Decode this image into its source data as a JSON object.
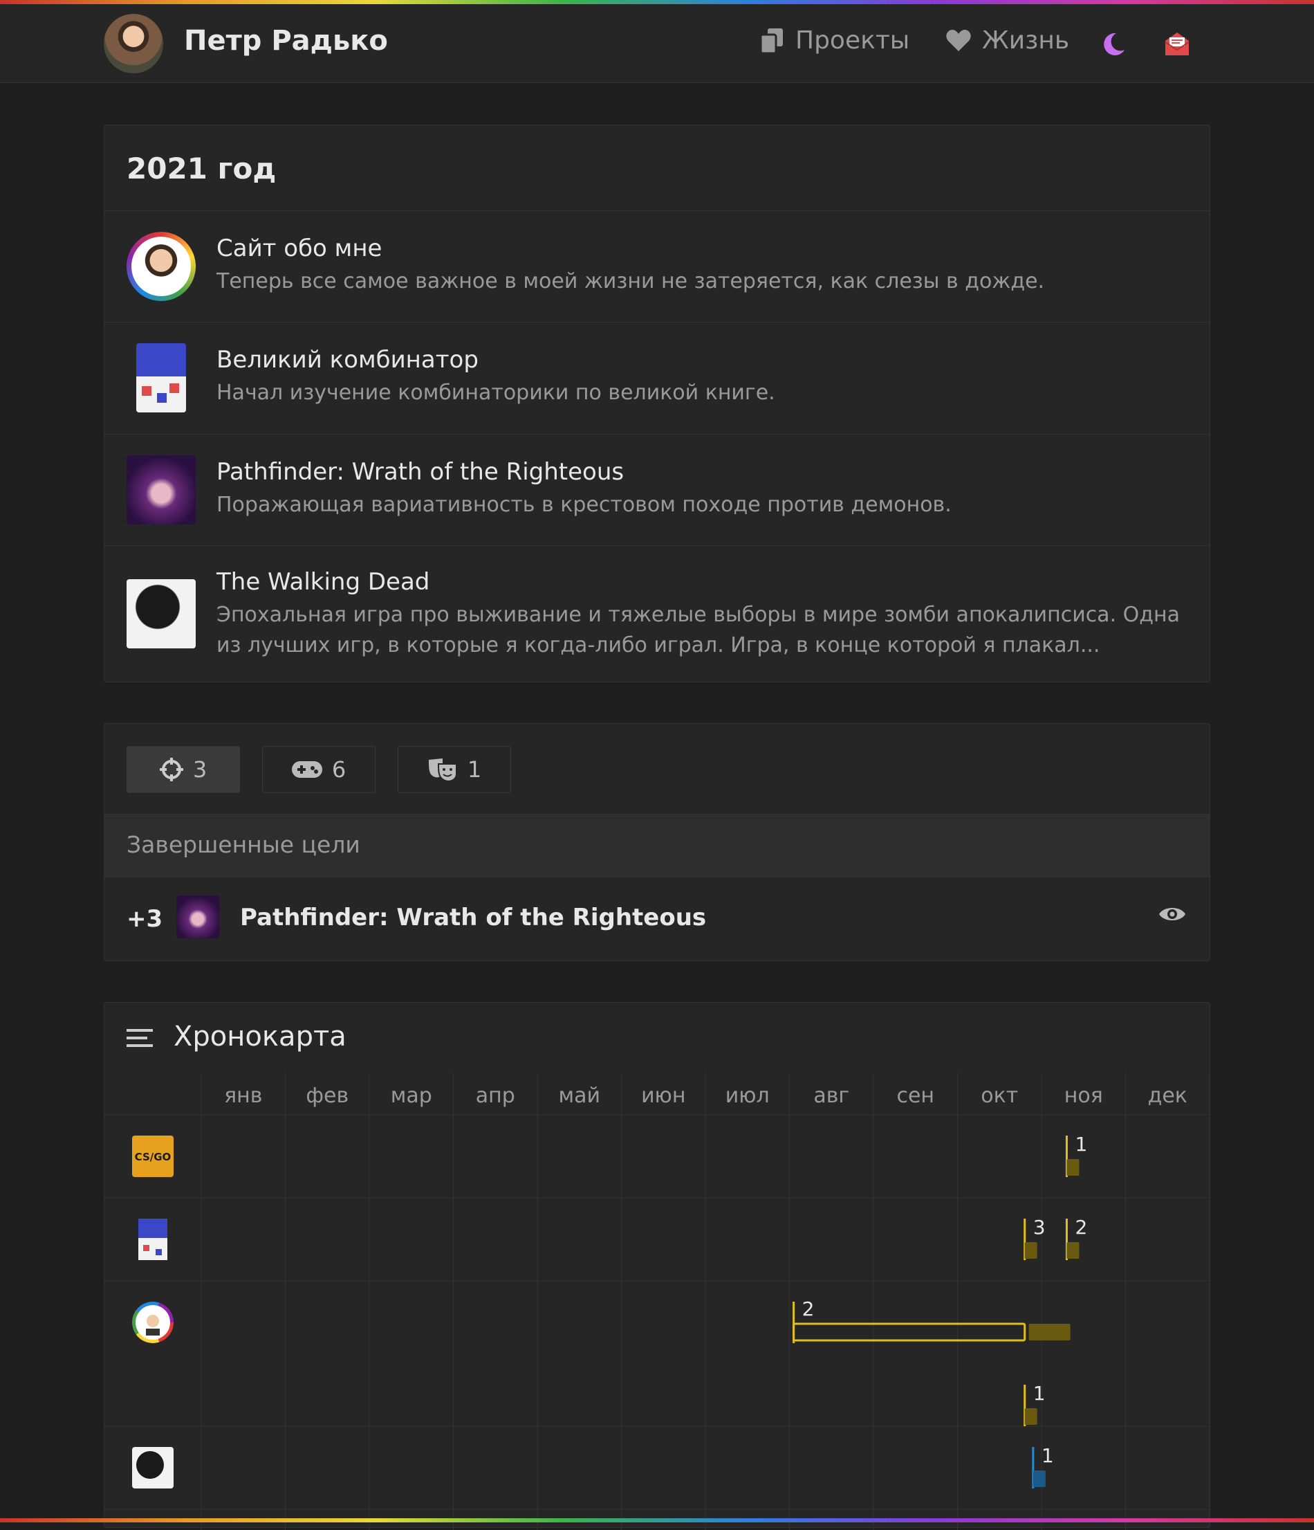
{
  "header": {
    "name": "Петр Радько",
    "nav": [
      {
        "label": "Проекты",
        "icon": "copy-icon"
      },
      {
        "label": "Жизнь",
        "icon": "heart-icon"
      }
    ],
    "theme_icon": "moon-icon",
    "mail_icon": "mail-icon",
    "colors": {
      "moon": "#c96ef0",
      "mail": "#e04a4a"
    }
  },
  "year_panel": {
    "title": "2021 год",
    "items": [
      {
        "title": "Сайт обо мне",
        "desc": "Теперь все самое важное в моей жизни не затеряется, как слезы в дожде."
      },
      {
        "title": "Великий комбинатор",
        "desc": "Начал изучение комбинаторики по великой книге."
      },
      {
        "title": "Pathfinder: Wrath of the Righteous",
        "desc": "Поражающая вариативность в крестовом походе против демонов."
      },
      {
        "title": "The Walking Dead",
        "desc": "Эпохальная игра про выживание и тяжелые выборы в мире зомби апокалипсиса. Одна из лучших игр, в которые я когда-либо играл. Игра, в конце которой я плакал..."
      }
    ]
  },
  "stats_panel": {
    "tabs": [
      {
        "icon": "crosshair-icon",
        "count": "3",
        "active": true
      },
      {
        "icon": "gamepad-icon",
        "count": "6",
        "active": false
      },
      {
        "icon": "masks-icon",
        "count": "1",
        "active": false
      }
    ],
    "section_label": "Завершенные цели",
    "goal": {
      "count": "+3",
      "title": "Pathfinder: Wrath of the Righteous"
    }
  },
  "chronomap": {
    "title": "Хронокарта",
    "months": [
      "янв",
      "фев",
      "мар",
      "апр",
      "май",
      "июн",
      "июл",
      "авг",
      "сен",
      "окт",
      "ноя",
      "дек"
    ],
    "rows": [
      {
        "icon": "csgo-logo",
        "marks": [
          {
            "label": "1",
            "month": 10.3,
            "color": "#e0c020"
          }
        ]
      },
      {
        "icon": "book-cover",
        "marks": [
          {
            "label": "3",
            "month": 9.8,
            "color": "#e0c020"
          },
          {
            "label": "2",
            "month": 10.3,
            "color": "#e0c020"
          }
        ]
      },
      {
        "icon": "ring-avatar",
        "marks": [
          {
            "label": "2",
            "start": 7.05,
            "end": 9.8,
            "color": "#e0c020"
          }
        ]
      },
      {
        "icon": "",
        "marks": [
          {
            "label": "1",
            "month": 9.8,
            "color": "#e0c020"
          }
        ]
      },
      {
        "icon": "walking-dead-cover",
        "marks": [
          {
            "label": "1",
            "month": 9.9,
            "color": "#2a8ad0"
          }
        ]
      }
    ]
  }
}
